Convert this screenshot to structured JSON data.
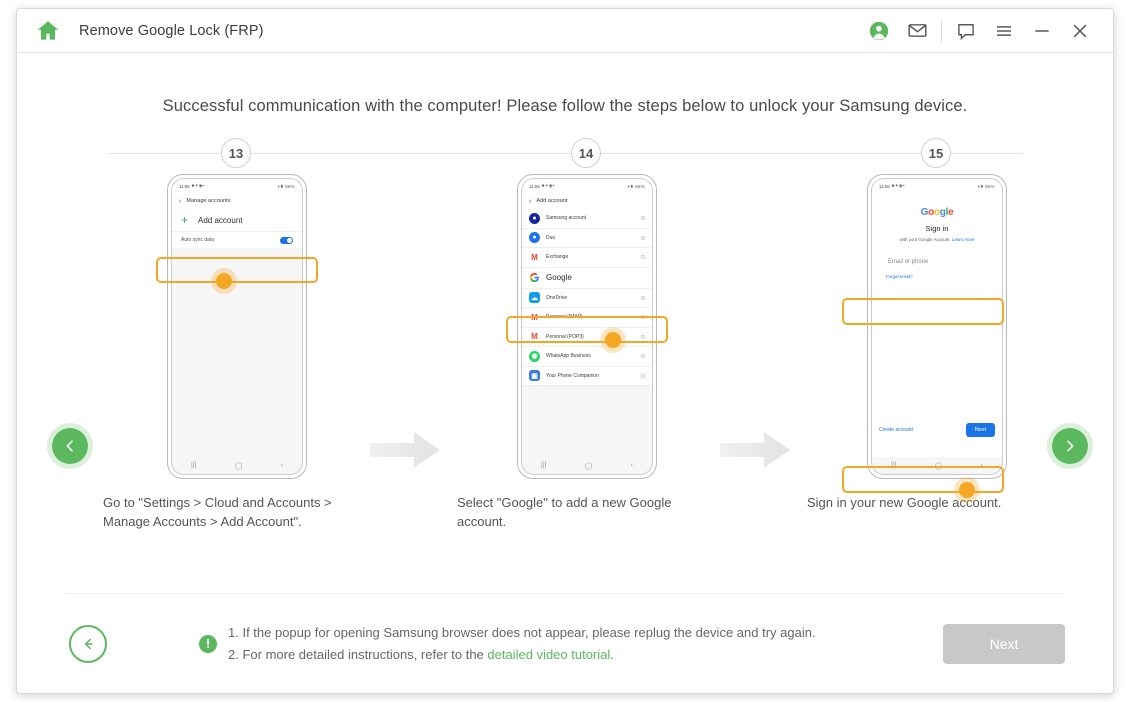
{
  "window": {
    "title": "Remove Google Lock (FRP)",
    "icons": {
      "home": "home-icon",
      "account": "account-icon",
      "mail": "mail-icon",
      "feedback": "feedback-icon",
      "menu": "menu-icon",
      "minimize": "minimize-icon",
      "close": "close-icon"
    }
  },
  "heading": "Successful communication with the computer! Please follow the steps below to unlock your Samsung device.",
  "nav": {
    "prev": "‹",
    "next": "›"
  },
  "steps": [
    {
      "number": "13",
      "caption": "Go to \"Settings > Cloud and Accounts > Manage Accounts > Add Account\".",
      "phone": {
        "status_time": "11:55",
        "status_right": "88%",
        "appbar_title": "Manage accounts",
        "add_account_label": "Add account",
        "plus": "+",
        "auto_sync_label": "Auto sync data"
      }
    },
    {
      "number": "14",
      "caption": "Select \"Google\" to add a new Google account.",
      "phone": {
        "status_time": "11:55",
        "status_right": "88%",
        "appbar_title": "Add account",
        "accounts": [
          {
            "label": "Samsung account",
            "icon": "samsung-icon",
            "glyph": "●"
          },
          {
            "label": "Duo",
            "icon": "duo-icon",
            "glyph": "●"
          },
          {
            "label": "Exchange",
            "icon": "gmail-icon",
            "glyph": "M"
          },
          {
            "label": "Google",
            "icon": "google-icon",
            "glyph": "G"
          },
          {
            "label": "OneDrive",
            "icon": "onedrive-icon",
            "glyph": "☁"
          },
          {
            "label": "Personal (IMAP)",
            "icon": "gmail-icon",
            "glyph": "M"
          },
          {
            "label": "Personal (POP3)",
            "icon": "gmail-icon",
            "glyph": "M"
          },
          {
            "label": "WhatsApp Business",
            "icon": "whatsapp-icon",
            "glyph": "◎"
          },
          {
            "label": "Your Phone Companion",
            "icon": "phone-companion-icon",
            "glyph": "▣"
          }
        ]
      }
    },
    {
      "number": "15",
      "caption": "Sign in your new Google account.",
      "phone": {
        "status_time": "11:56",
        "status_right": "88%",
        "google_logo": [
          "G",
          "o",
          "o",
          "g",
          "l",
          "e"
        ],
        "signin_title": "Sign in",
        "signin_sub": "with your Google Account.",
        "signin_link": "Learn more",
        "email_placeholder": "Email or phone",
        "forgot_email": "Forgot email?",
        "create_account": "Create account",
        "next_label": "Next"
      }
    }
  ],
  "footer": {
    "back_icon": "arrow-left-icon",
    "note_badge": "!",
    "note_line1": "1. If the popup for opening Samsung browser does not appear, please replug the device and try again.",
    "note_line2_pre": "2. For more detailed instructions, refer to the ",
    "note_link": "detailed video tutorial",
    "note_line2_post": ".",
    "next_label": "Next"
  },
  "colors": {
    "accent_green": "#5cb85c",
    "highlight_orange": "#f5a623",
    "google_blue": "#1a73e8",
    "disabled_gray": "#c8c8c8"
  }
}
